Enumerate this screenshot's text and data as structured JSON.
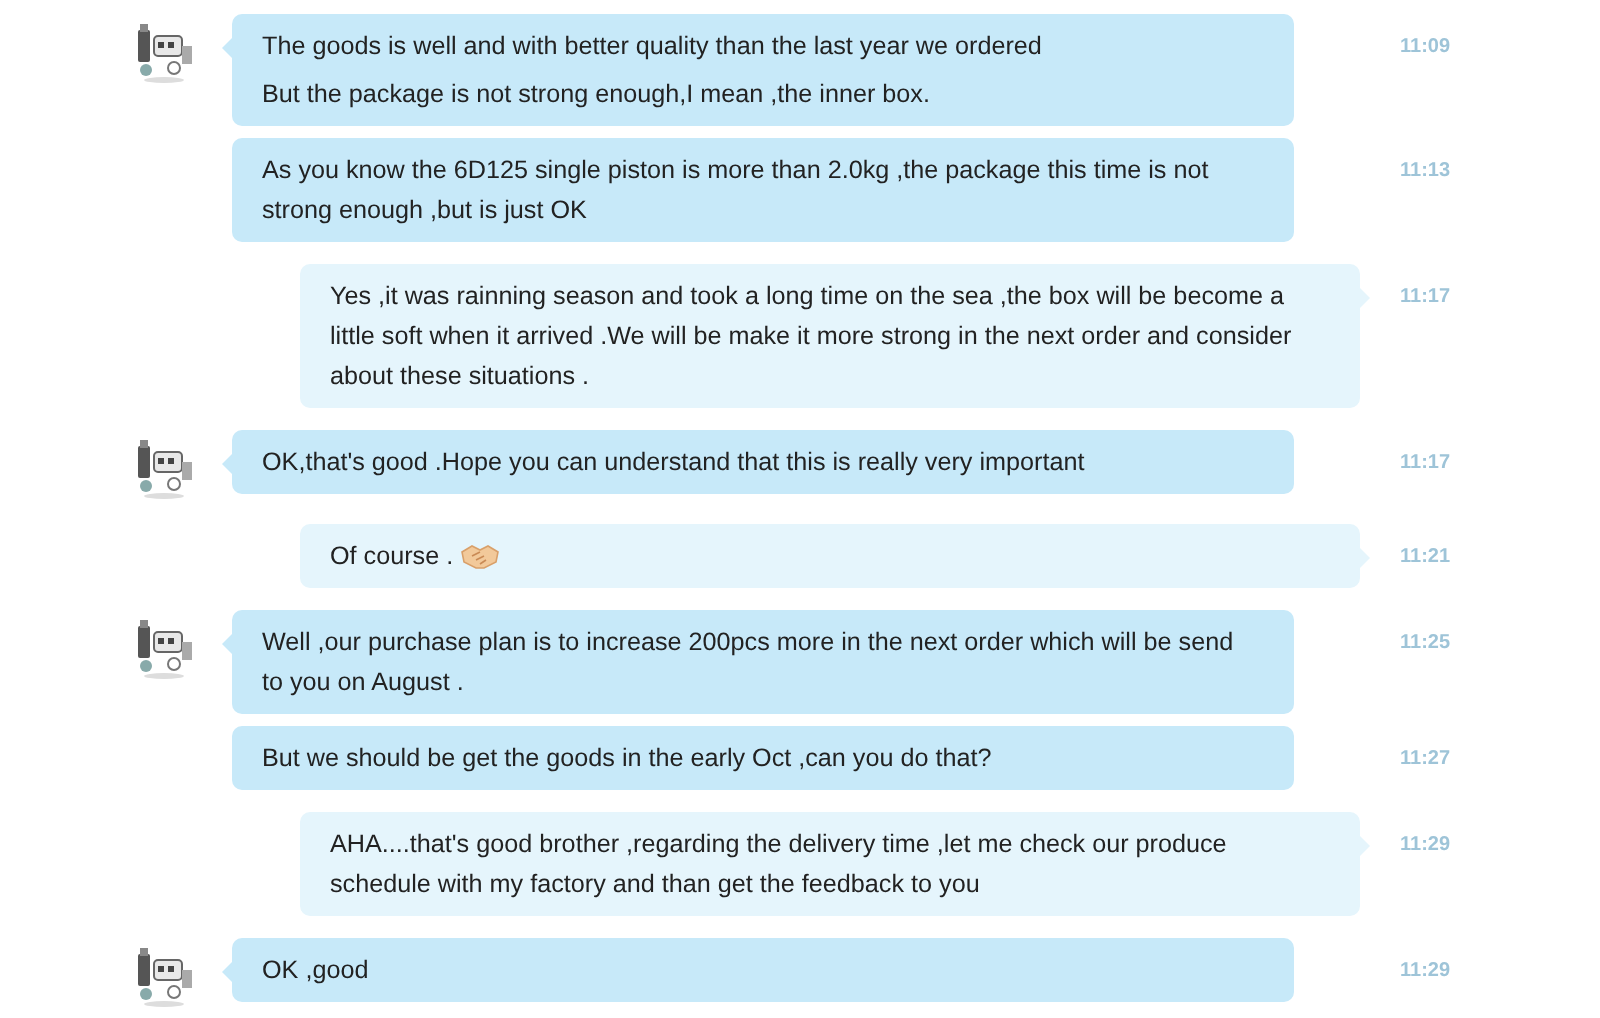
{
  "messages": [
    {
      "kind": "received",
      "show_avatar": true,
      "paragraphs": [
        "The goods is well and with better quality than the last year we ordered",
        "But the package is not strong enough,I mean ,the inner box."
      ],
      "time": "11:09"
    },
    {
      "kind": "received",
      "show_avatar": false,
      "paragraphs": [
        "As you know the 6D125 single piston is more than 2.0kg ,the package this time is not\nstrong enough ,but is just OK"
      ],
      "time": "11:13"
    },
    {
      "kind": "sent",
      "show_avatar": false,
      "paragraphs": [
        "Yes ,it was rainning season and took a long time on the sea ,the box will be become a\nlittle soft when it arrived .We will be make it more strong in the next order and consider\nabout these situations ."
      ],
      "time": "11:17"
    },
    {
      "kind": "received",
      "show_avatar": true,
      "paragraphs": [
        "OK,that's good .Hope you can understand that this is really very important"
      ],
      "time": "11:17"
    },
    {
      "kind": "sent",
      "show_avatar": false,
      "paragraphs": [
        "Of course ."
      ],
      "emoji": true,
      "time": "11:21"
    },
    {
      "kind": "received",
      "show_avatar": true,
      "paragraphs": [
        "Well ,our purchase plan is to increase 200pcs more in the next order which will be send\nto you on August ."
      ],
      "time": "11:25"
    },
    {
      "kind": "received",
      "show_avatar": false,
      "paragraphs": [
        "But we should be get the goods in the early Oct ,can you do that?"
      ],
      "time": "11:27"
    },
    {
      "kind": "sent",
      "show_avatar": false,
      "paragraphs": [
        "AHA....that's good brother ,regarding the delivery time ,let me check our produce\nschedule with my factory and than get the feedback to you"
      ],
      "time": "11:29"
    },
    {
      "kind": "received",
      "show_avatar": true,
      "paragraphs": [
        "OK ,good"
      ],
      "time": "11:29"
    }
  ]
}
